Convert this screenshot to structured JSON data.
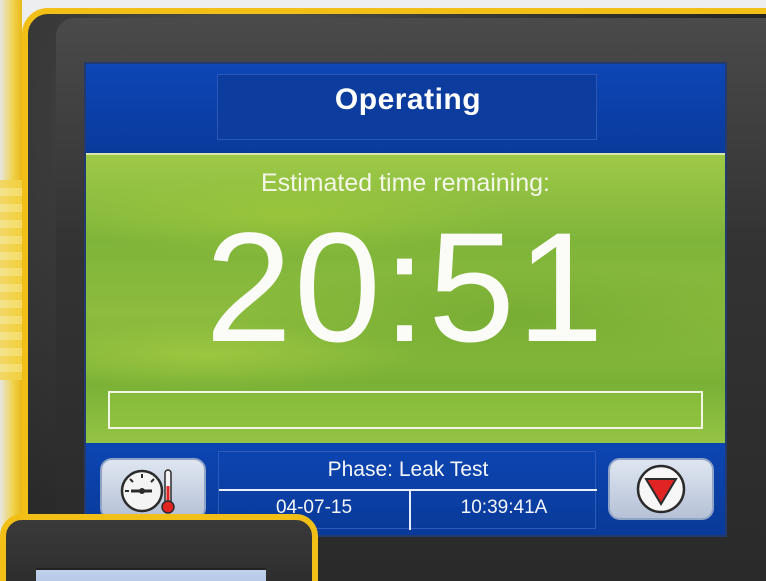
{
  "screen": {
    "title": "Operating",
    "subtitle": "Estimated time remaining:",
    "timer": "20:51",
    "progress_fraction": 0.0
  },
  "bottom_bar": {
    "phase": "Phase: Leak Test",
    "date": "04-07-15",
    "time": "10:39:41A"
  },
  "icons": {
    "left_button": "gauge-thermometer-icon",
    "right_button": "stop-triangle-icon"
  },
  "colors": {
    "accent_yellow": "#f2bf16",
    "screen_blue": "#0b3c9e",
    "panel_green": "#8cbc3e",
    "stop_red": "#e02323"
  }
}
